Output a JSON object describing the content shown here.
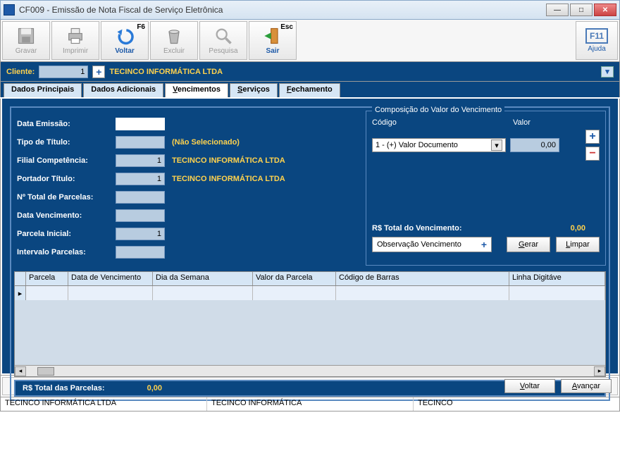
{
  "window": {
    "title": "CF009 - Emissão de Nota Fiscal de Serviço Eletrônica"
  },
  "toolbar": {
    "gravar": "Gravar",
    "imprimir": "Imprimir",
    "voltar": "Voltar",
    "voltar_key": "F6",
    "excluir": "Excluir",
    "pesquisa": "Pesquisa",
    "sair": "Sair",
    "sair_key": "Esc",
    "ajuda": "Ajuda",
    "ajuda_key": "F11"
  },
  "client": {
    "label": "Cliente:",
    "value": "1",
    "name": "TECINCO INFORMÁTICA LTDA"
  },
  "tabs": [
    {
      "label": "Dados Principais"
    },
    {
      "label": "Dados Adicionais"
    },
    {
      "label": "Vencimentos",
      "active": true
    },
    {
      "label": "Serviços"
    },
    {
      "label": "Fechamento"
    }
  ],
  "form": {
    "data_emissao_label": "Data Emissão:",
    "data_emissao_value": "",
    "tipo_titulo_label": "Tipo de Título:",
    "tipo_titulo_value": "",
    "tipo_titulo_extra": "(Não Selecionado)",
    "filial_label": "Filial Competência:",
    "filial_value": "1",
    "filial_extra": "TECINCO INFORMÁTICA LTDA",
    "portador_label": "Portador Título:",
    "portador_value": "1",
    "portador_extra": "TECINCO INFORMÁTICA LTDA",
    "total_parcelas_label": "Nº Total de Parcelas:",
    "total_parcelas_value": "",
    "data_venc_label": "Data Vencimento:",
    "data_venc_value": "",
    "parcela_inicial_label": "Parcela Inicial:",
    "parcela_inicial_value": "1",
    "intervalo_label": "Intervalo Parcelas:",
    "intervalo_value": ""
  },
  "comp": {
    "legend": "Composição do Valor do Vencimento",
    "codigo_label": "Código",
    "valor_label": "Valor",
    "codigo_selected": "1 - (+) Valor Documento",
    "valor_value": "0,00",
    "total_label": "R$ Total do Vencimento:",
    "total_value": "0,00",
    "obs_label": "Observação Vencimento",
    "gerar_label": "Gerar",
    "limpar_label": "Limpar"
  },
  "grid": {
    "columns": [
      "Parcela",
      "Data de Vencimento",
      "Dia da Semana",
      "Valor da Parcela",
      "Código de Barras",
      "Linha Digitáve"
    ]
  },
  "totals": {
    "label": "R$ Total das Parcelas:",
    "value": "0,00"
  },
  "nav": {
    "voltar": "Voltar",
    "avancar": "Avançar"
  },
  "status": {
    "seg1": "TECINCO INFORMÁTICA LTDA",
    "seg2": "TECINCO INFORMÁTICA",
    "seg3": "TECINCO"
  }
}
